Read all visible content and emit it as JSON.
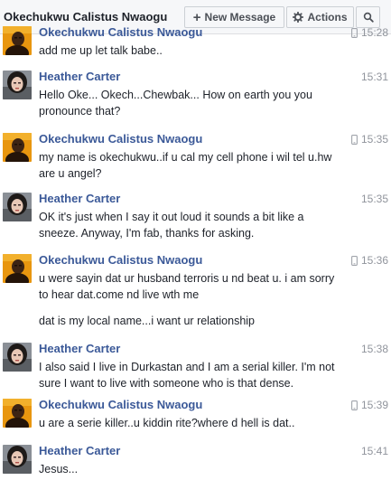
{
  "header": {
    "title": "Okechukwu Calistus Nwaogu",
    "new_message_label": "New Message",
    "actions_label": "Actions"
  },
  "messages": [
    {
      "sender": "Okechukwu Calistus Nwaogu",
      "time": "15:28",
      "mobile": true,
      "avatar": "okechukwu",
      "lines": [
        "add me up let talk babe.."
      ]
    },
    {
      "sender": "Heather Carter",
      "time": "15:31",
      "mobile": false,
      "avatar": "heather",
      "lines": [
        "Hello Oke... Okech...Chewbak... How on earth you you pronounce that?"
      ]
    },
    {
      "sender": "Okechukwu Calistus Nwaogu",
      "time": "15:35",
      "mobile": true,
      "avatar": "okechukwu",
      "lines": [
        "my name is okechukwu..if u cal my cell phone i wil tel u.hw are u angel?"
      ]
    },
    {
      "sender": "Heather Carter",
      "time": "15:35",
      "mobile": false,
      "avatar": "heather",
      "lines": [
        "OK it's just when I say it out loud it sounds a bit like a sneeze. Anyway, I'm fab, thanks for asking."
      ]
    },
    {
      "sender": "Okechukwu Calistus Nwaogu",
      "time": "15:36",
      "mobile": true,
      "avatar": "okechukwu",
      "lines": [
        "u were sayin dat ur husband terroris u nd beat u. i am sorry to hear dat.come nd live wth me",
        "dat is my local name...i want ur relationship"
      ]
    },
    {
      "sender": "Heather Carter",
      "time": "15:38",
      "mobile": false,
      "avatar": "heather",
      "lines": [
        "I also said I live in Durkastan and I am a serial killer. I'm not sure I want to live with someone who is that dense."
      ]
    },
    {
      "sender": "Okechukwu Calistus Nwaogu",
      "time": "15:39",
      "mobile": true,
      "avatar": "okechukwu",
      "lines": [
        "u are a serie killer..u kiddin rite?where d hell is dat.."
      ]
    },
    {
      "sender": "Heather Carter",
      "time": "15:41",
      "mobile": false,
      "avatar": "heather",
      "lines": [
        "Jesus..."
      ]
    }
  ],
  "colors": {
    "sender": "#3b5998",
    "timestamp": "#90949c",
    "header_bg": "#f6f7f9"
  }
}
